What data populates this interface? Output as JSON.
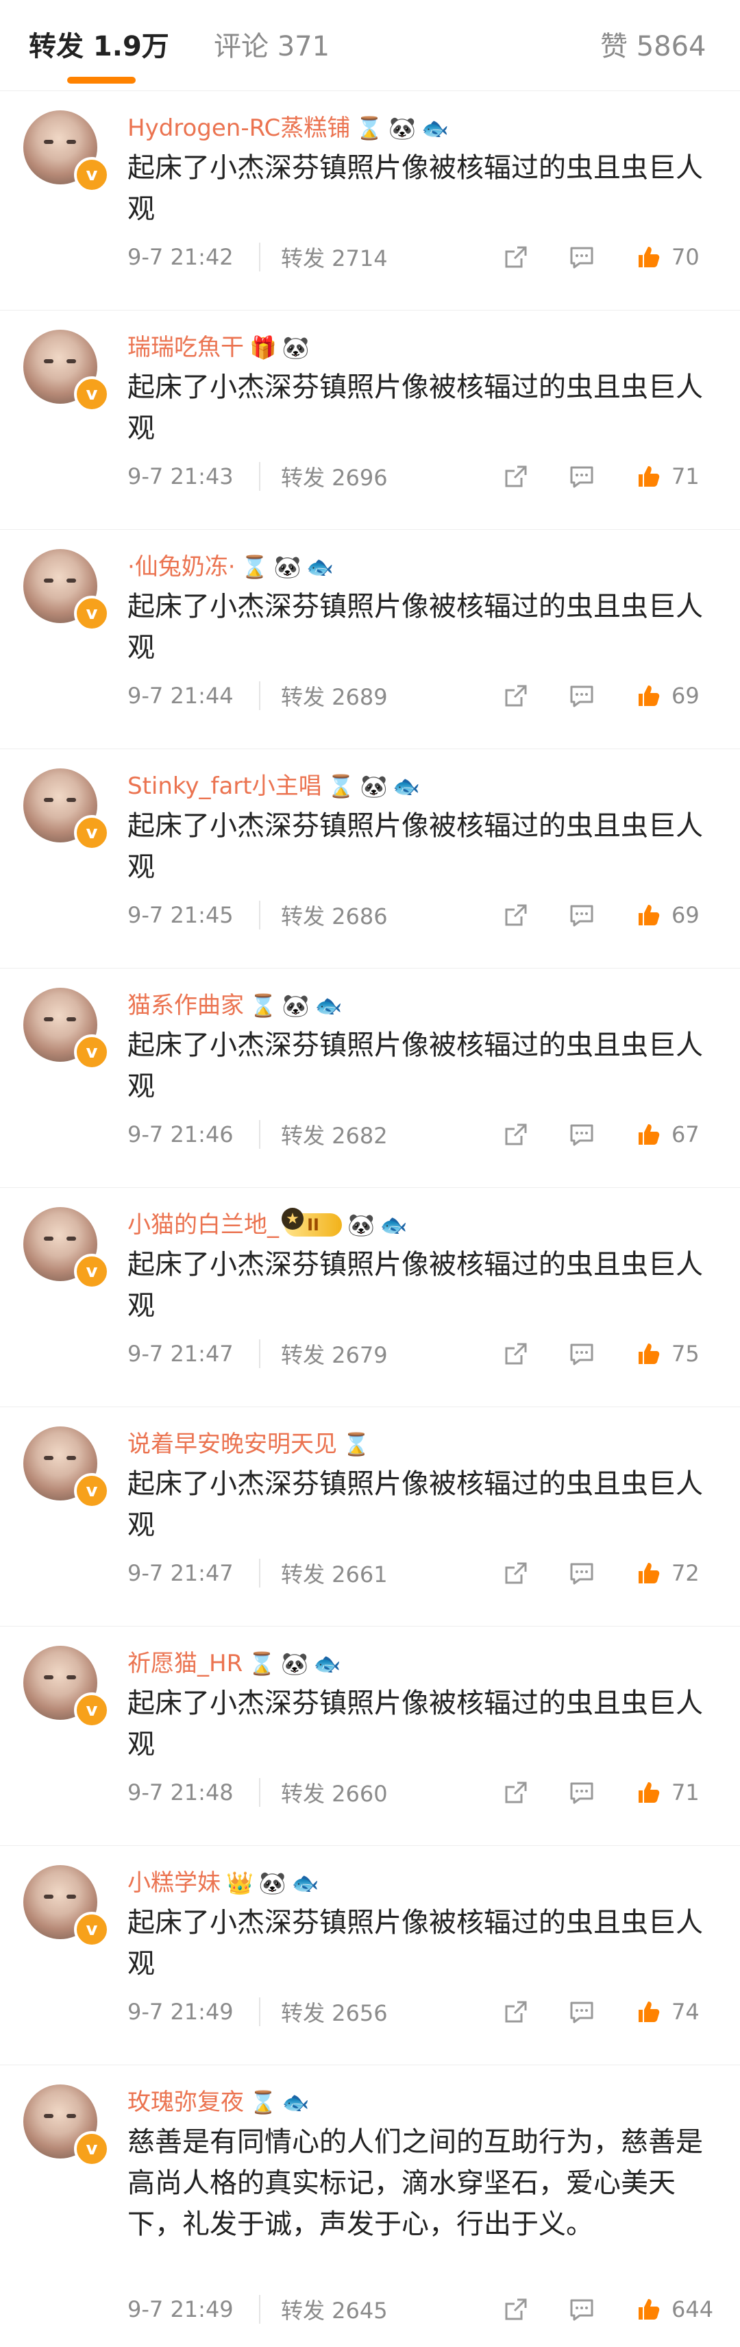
{
  "tabs": [
    {
      "label": "转发 1.9万",
      "active": true
    },
    {
      "label": "评论 371",
      "active": false
    },
    {
      "label": "赞 5864",
      "active": false
    }
  ],
  "colors": {
    "accent": "#ff8200",
    "name": "#eb7350",
    "meta": "#8b8b8b",
    "like": "#ff8200"
  },
  "posts": [
    {
      "name": "Hydrogen-RC蒸糕铺",
      "emojis": [
        "hourglass",
        "panda",
        "fish"
      ],
      "text": "起床了小杰深芬镇照片像被核辐过的虫且虫巨人观",
      "time": "9-7 21:42",
      "repost": "转发 2714",
      "likes": "70"
    },
    {
      "name": "瑞瑞吃魚干",
      "emojis": [
        "gift",
        "panda"
      ],
      "text": "起床了小杰深芬镇照片像被核辐过的虫且虫巨人观",
      "time": "9-7 21:43",
      "repost": "转发 2696",
      "likes": "71"
    },
    {
      "name": "·仙兔奶冻·",
      "emojis": [
        "hourglass",
        "panda",
        "fish"
      ],
      "text": "起床了小杰深芬镇照片像被核辐过的虫且虫巨人观",
      "time": "9-7 21:44",
      "repost": "转发 2689",
      "likes": "69"
    },
    {
      "name": "Stinky_fart小主唱",
      "emojis": [
        "hourglass",
        "panda",
        "fish"
      ],
      "text": "起床了小杰深芬镇照片像被核辐过的虫且虫巨人观",
      "time": "9-7 21:45",
      "repost": "转发 2686",
      "likes": "69"
    },
    {
      "name": "猫系作曲家",
      "emojis": [
        "hourglass",
        "panda",
        "fish"
      ],
      "text": "起床了小杰深芬镇照片像被核辐过的虫且虫巨人观",
      "time": "9-7 21:46",
      "repost": "转发 2682",
      "likes": "67"
    },
    {
      "name": "小猫的白兰地_",
      "emojis": [
        "vip",
        "panda",
        "fish"
      ],
      "vip_label": "II",
      "text": "起床了小杰深芬镇照片像被核辐过的虫且虫巨人观",
      "time": "9-7 21:47",
      "repost": "转发 2679",
      "likes": "75"
    },
    {
      "name": "说着早安晚安明天见",
      "emojis": [
        "hourglass"
      ],
      "text": "起床了小杰深芬镇照片像被核辐过的虫且虫巨人观",
      "time": "9-7 21:47",
      "repost": "转发 2661",
      "likes": "72"
    },
    {
      "name": "祈愿猫_HR",
      "emojis": [
        "hourglass",
        "panda",
        "fish"
      ],
      "text": "起床了小杰深芬镇照片像被核辐过的虫且虫巨人观",
      "time": "9-7 21:48",
      "repost": "转发 2660",
      "likes": "71"
    },
    {
      "name": "小糕学妹",
      "emojis": [
        "crown",
        "panda",
        "fish"
      ],
      "text": "起床了小杰深芬镇照片像被核辐过的虫且虫巨人观",
      "time": "9-7 21:49",
      "repost": "转发 2656",
      "likes": "74"
    },
    {
      "name": "玫瑰弥复夜",
      "emojis": [
        "hourglass",
        "fish"
      ],
      "text": "慈善是有同情心的人们之间的互助行为，慈善是高尚人格的真实标记，滴水穿坚石，爱心美天下，礼发于诚，声发于心，行出于义。",
      "time": "9-7 21:49",
      "repost": "转发 2645",
      "likes": "644"
    }
  ]
}
